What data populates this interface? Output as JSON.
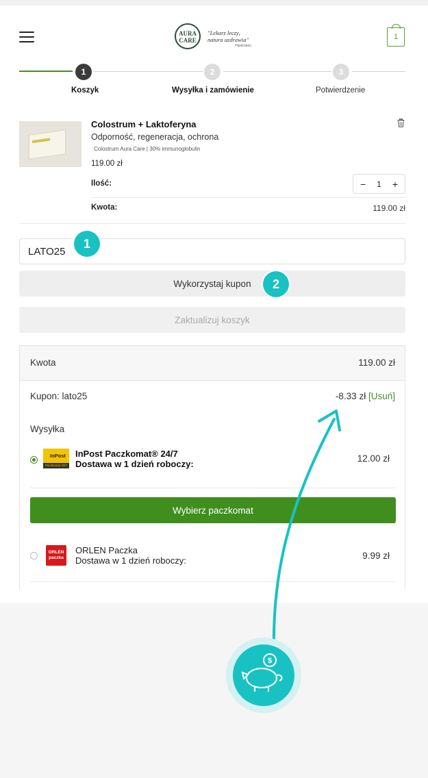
{
  "header": {
    "logo_line1": "AURA",
    "logo_line2": "CARE",
    "tagline_1": "\"Lekarz leczy,",
    "tagline_2": "natura uzdrawia\"",
    "tagline_author": "Hipokrates",
    "cart_count": "1"
  },
  "steps": [
    {
      "number": "1",
      "label": "Koszyk",
      "state": "active"
    },
    {
      "number": "2",
      "label": "Wysyłka i zamówienie",
      "state": "pending"
    },
    {
      "number": "3",
      "label": "Potwierdzenie",
      "state": "pending"
    }
  ],
  "product": {
    "name": "Colostrum + Laktoferyna",
    "subtitle": "Odporność, regeneracja, ochrona",
    "details": "Colostrum Aura Care | 30% immunoglobulin",
    "price": "119.00 zł",
    "quantity_label": "Ilość:",
    "quantity": "1",
    "amount_label": "Kwota:",
    "amount": "119.00 zł"
  },
  "coupon": {
    "value": "LATO25",
    "apply_label": "Wykorzystaj kupon",
    "update_label": "Zaktualizuj koszyk"
  },
  "annotations": {
    "badge1": "1",
    "badge2": "2"
  },
  "totals": {
    "amount_label": "Kwota",
    "amount": "119.00 zł",
    "coupon_label": "Kupon: lato25",
    "coupon_discount": "-8.33 zł",
    "remove_label": "[Usuń]",
    "shipping_label": "Wysyłka",
    "options": [
      {
        "name_line1": "InPost Paczkomat® 24/7",
        "name_line2": "Dostawa w 1 dzień roboczy:",
        "price": "12.00 zł",
        "logo": "InPost",
        "logo_sub": "Paczkomat 24/7",
        "selected": true
      },
      {
        "name_line1": "ORLEN Paczka",
        "name_line2": "Dostawa w 1 dzień roboczy:",
        "price": "9.99 zł",
        "logo_line1": "ORLEN",
        "logo_line2": "paczka",
        "selected": false
      }
    ],
    "locker_button": "Wybierz paczkomat"
  },
  "colors": {
    "accent_green": "#3f8e1e",
    "annotation_teal": "#19c2c2"
  }
}
